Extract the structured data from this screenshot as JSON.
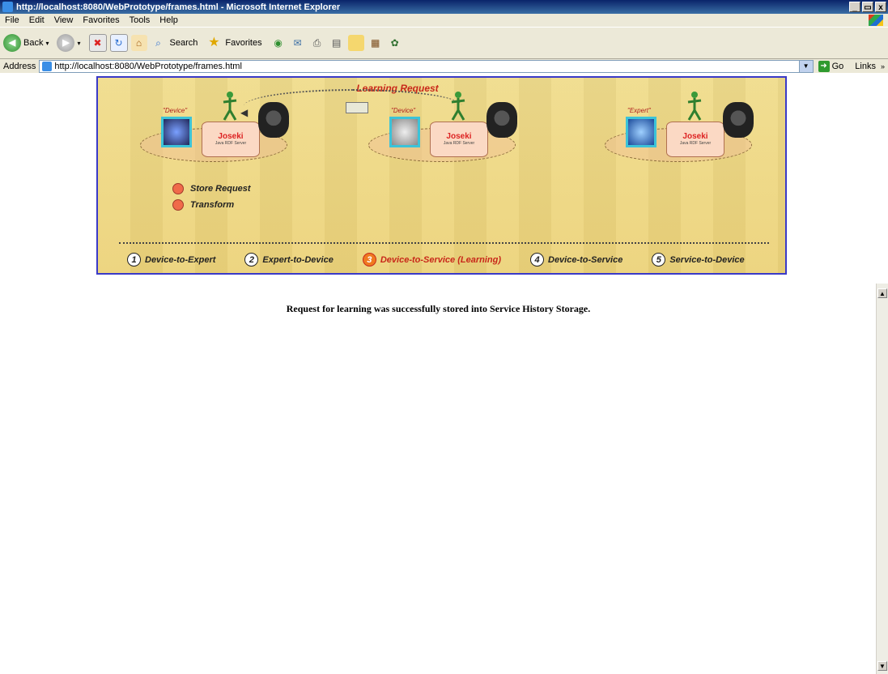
{
  "window": {
    "title": "http://localhost:8080/WebPrototype/frames.html - Microsoft Internet Explorer",
    "buttons": {
      "minimize": "_",
      "maximize": "▭",
      "close": "x"
    }
  },
  "menu": [
    "File",
    "Edit",
    "View",
    "Favorites",
    "Tools",
    "Help"
  ],
  "toolbar": {
    "back": "Back",
    "search": "Search",
    "favorites": "Favorites"
  },
  "address": {
    "label": "Address",
    "url": "http://localhost:8080/WebPrototype/frames.html",
    "go": "Go",
    "links": "Links"
  },
  "banner": {
    "title": "Learning Request",
    "nodes": [
      {
        "tag": "\"Device\"",
        "db": "Joseki",
        "db_sub": "Java RDF Server"
      },
      {
        "tag": "\"Device\"",
        "db": "Joseki",
        "db_sub": "Java RDF Server"
      },
      {
        "tag": "\"Expert\"",
        "db": "Joseki",
        "db_sub": "Java RDF Server"
      }
    ],
    "legend": [
      "Store Request",
      "Transform"
    ],
    "tabs": [
      {
        "num": "1",
        "label": "Device-to-Expert"
      },
      {
        "num": "2",
        "label": "Expert-to-Device"
      },
      {
        "num": "3",
        "label": "Device-to-Service (Learning)"
      },
      {
        "num": "4",
        "label": "Device-to-Service"
      },
      {
        "num": "5",
        "label": "Service-to-Device"
      }
    ],
    "active_tab": 3,
    "colors": {
      "accent": "#c8281a",
      "border": "#3a3ac8",
      "background": "#ecd37a"
    }
  },
  "status_message": "Request for learning was successfully stored into Service History Storage."
}
